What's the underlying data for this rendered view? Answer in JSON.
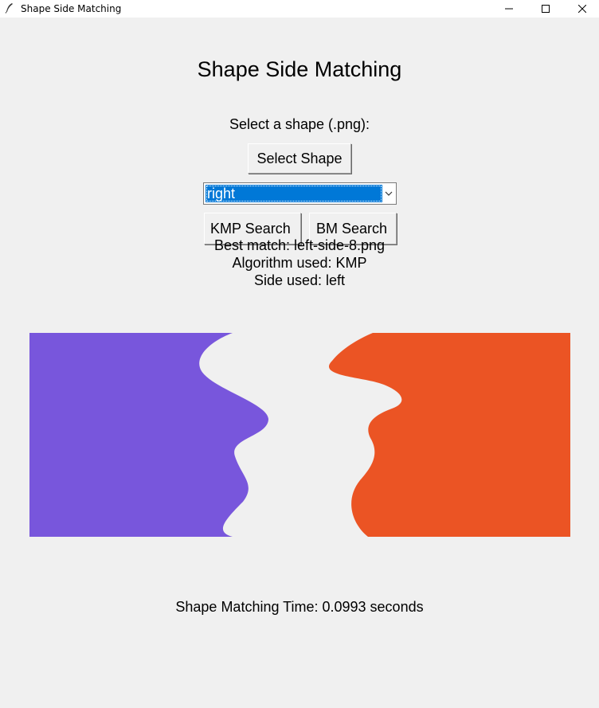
{
  "window": {
    "title": "Shape Side Matching",
    "icons": {
      "app": "feather-icon",
      "minimize": "minimize-icon",
      "maximize": "maximize-icon",
      "close": "close-icon"
    }
  },
  "main": {
    "heading": "Shape Side Matching",
    "select_label": "Select a shape (.png):",
    "select_button": "Select Shape",
    "side_dropdown": {
      "selected": "right",
      "icon": "chevron-down-icon"
    },
    "kmp_button": "KMP Search",
    "bm_button": "BM Search",
    "results": {
      "best_match": "Best match: left-side-8.png",
      "algorithm": "Algorithm used: KMP",
      "side": "Side used: left"
    },
    "shapes": {
      "left_color": "#7856dc",
      "right_color": "#eb5424"
    },
    "time_text": "Shape Matching Time: 0.0993 seconds"
  }
}
